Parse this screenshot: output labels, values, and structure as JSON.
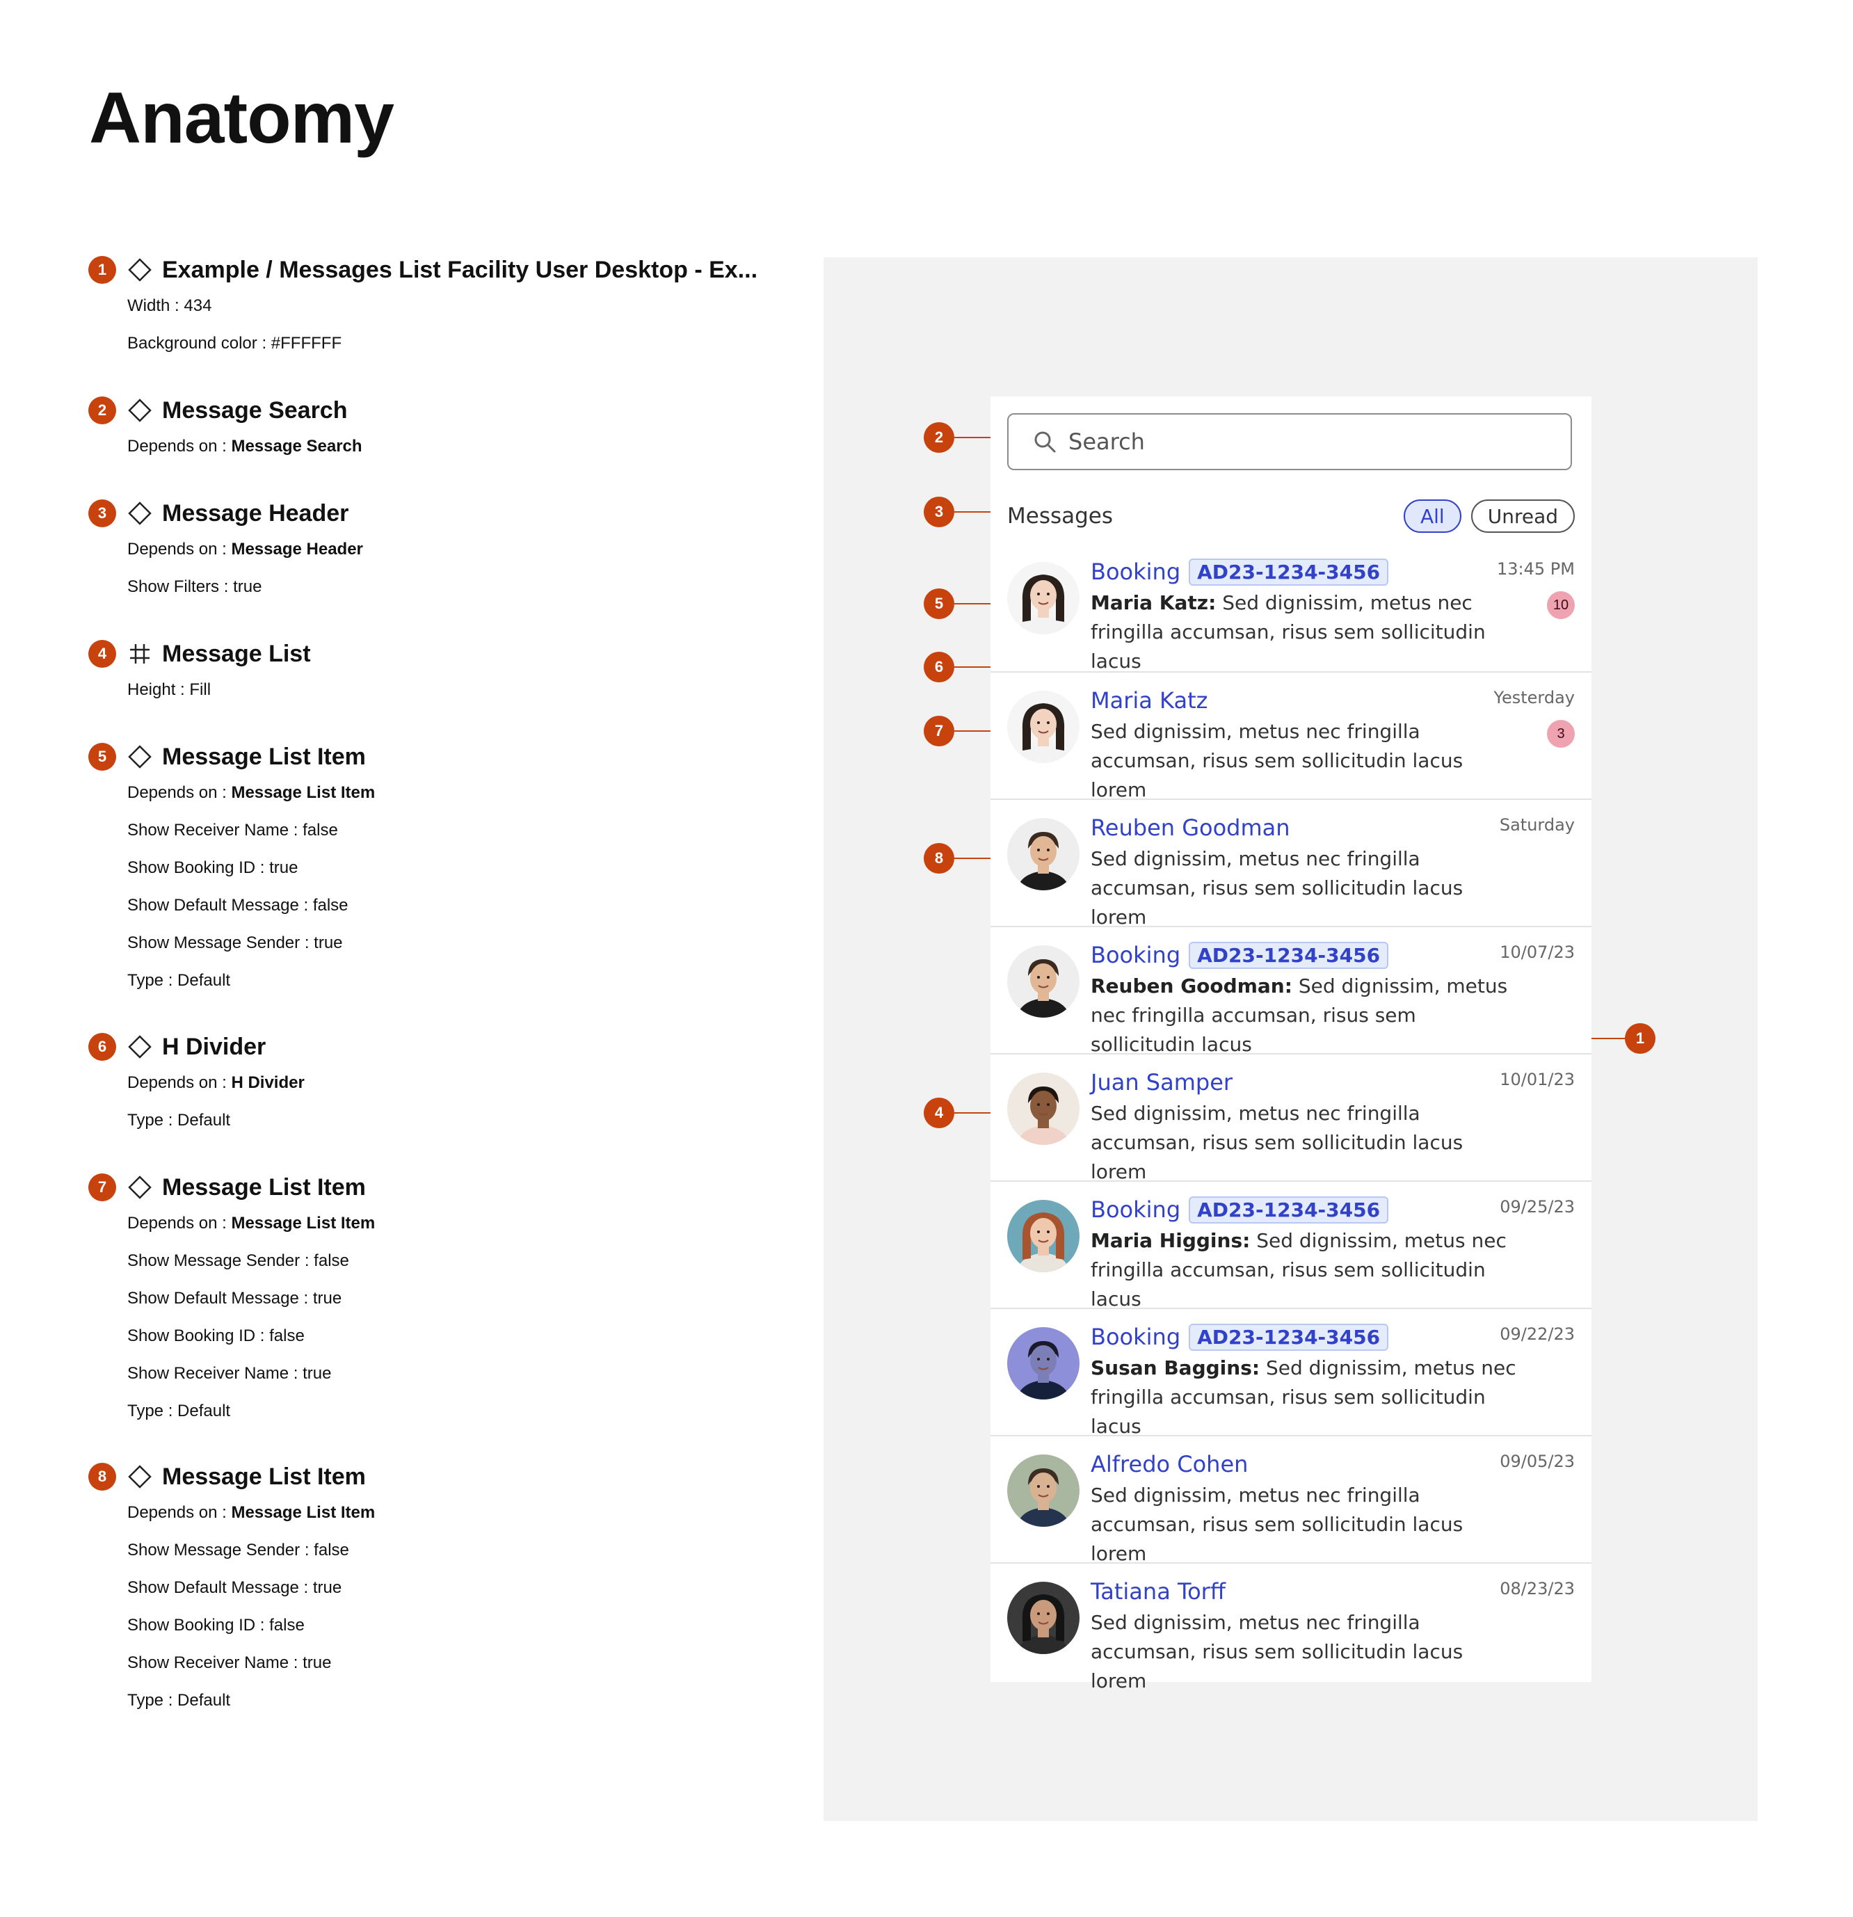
{
  "page_title": "Anatomy",
  "specs": [
    {
      "num": "1",
      "icon": "component-diamond-icon",
      "title": "Example / Messages List Facility User Desktop - Ex...",
      "props": [
        {
          "k": "Width",
          "v": "434",
          "bold": false
        },
        {
          "k": "Background color",
          "v": "#FFFFFF",
          "bold": false
        }
      ]
    },
    {
      "num": "2",
      "icon": "component-diamond-icon",
      "title": "Message Search",
      "props": [
        {
          "k": "Depends on",
          "v": "Message Search",
          "bold": true
        }
      ]
    },
    {
      "num": "3",
      "icon": "component-diamond-icon",
      "title": "Message Header",
      "props": [
        {
          "k": "Depends on",
          "v": "Message Header",
          "bold": true
        },
        {
          "k": "Show Filters",
          "v": "true",
          "bold": false
        }
      ]
    },
    {
      "num": "4",
      "icon": "frame-hash-icon",
      "title": "Message List",
      "props": [
        {
          "k": "Height",
          "v": "Fill",
          "bold": false
        }
      ]
    },
    {
      "num": "5",
      "icon": "component-diamond-icon",
      "title": "Message List Item",
      "props": [
        {
          "k": "Depends on",
          "v": "Message List Item",
          "bold": true
        },
        {
          "k": "Show Receiver Name",
          "v": "false",
          "bold": false
        },
        {
          "k": "Show Booking ID",
          "v": "true",
          "bold": false
        },
        {
          "k": "Show Default Message",
          "v": "false",
          "bold": false
        },
        {
          "k": "Show Message Sender",
          "v": "true",
          "bold": false
        },
        {
          "k": "Type",
          "v": "Default",
          "bold": false
        }
      ]
    },
    {
      "num": "6",
      "icon": "component-diamond-icon",
      "title": "H Divider",
      "props": [
        {
          "k": "Depends on",
          "v": "H Divider",
          "bold": true
        },
        {
          "k": "Type",
          "v": "Default",
          "bold": false
        }
      ]
    },
    {
      "num": "7",
      "icon": "component-diamond-icon",
      "title": "Message List Item",
      "props": [
        {
          "k": "Depends on",
          "v": "Message List Item",
          "bold": true
        },
        {
          "k": "Show Message Sender",
          "v": "false",
          "bold": false
        },
        {
          "k": "Show Default Message",
          "v": "true",
          "bold": false
        },
        {
          "k": "Show Booking ID",
          "v": "false",
          "bold": false
        },
        {
          "k": "Show Receiver Name",
          "v": "true",
          "bold": false
        },
        {
          "k": "Type",
          "v": "Default",
          "bold": false
        }
      ]
    },
    {
      "num": "8",
      "icon": "component-diamond-icon",
      "title": "Message List Item",
      "props": [
        {
          "k": "Depends on",
          "v": "Message List Item",
          "bold": true
        },
        {
          "k": "Show Message Sender",
          "v": "false",
          "bold": false
        },
        {
          "k": "Show Default Message",
          "v": "true",
          "bold": false
        },
        {
          "k": "Show Booking ID",
          "v": "false",
          "bold": false
        },
        {
          "k": "Show Receiver Name",
          "v": "true",
          "bold": false
        },
        {
          "k": "Type",
          "v": "Default",
          "bold": false
        }
      ]
    }
  ],
  "preview": {
    "search": {
      "placeholder": "Search",
      "icon": "search-icon"
    },
    "header": {
      "title": "Messages",
      "filters": [
        {
          "label": "All",
          "selected": true
        },
        {
          "label": "Unread",
          "selected": false
        }
      ]
    },
    "booking_word": "Booking",
    "messages": [
      {
        "type": "booking",
        "booking_id": "AD23-1234-3456",
        "sender": "Maria Katz:",
        "text": "Sed dignissim, metus nec fringilla accumsan, risus sem sollicitudin lacus",
        "time": "13:45 PM",
        "unread": "10",
        "avatar": {
          "skin": "#f1d3bf",
          "hair": "#2a201b",
          "shirt": "#f3f3f3",
          "bg": "#f5f5f5",
          "long": true
        }
      },
      {
        "type": "receiver",
        "name": "Maria Katz",
        "text": "Sed dignissim, metus nec fringilla accumsan, risus sem sollicitudin lacus lorem",
        "time": "Yesterday",
        "unread": "3",
        "avatar": {
          "skin": "#f1d3bf",
          "hair": "#2a201b",
          "shirt": "#f3f3f3",
          "bg": "#f5f5f5",
          "long": true
        }
      },
      {
        "type": "receiver",
        "name": "Reuben Goodman",
        "text": "Sed dignissim, metus nec fringilla accumsan, risus sem sollicitudin lacus lorem",
        "time": "Saturday",
        "unread": "",
        "avatar": {
          "skin": "#e2b795",
          "hair": "#3a2a20",
          "shirt": "#1c1c1c",
          "bg": "#eeeeee",
          "long": false
        }
      },
      {
        "type": "booking",
        "booking_id": "AD23-1234-3456",
        "sender": "Reuben Goodman:",
        "text": "Sed dignissim, metus nec fringilla accumsan, risus sem sollicitudin lacus",
        "time": "10/07/23",
        "unread": "",
        "avatar": {
          "skin": "#e2b795",
          "hair": "#3a2a20",
          "shirt": "#1c1c1c",
          "bg": "#eeeeee",
          "long": false
        }
      },
      {
        "type": "receiver",
        "name": "Juan Samper",
        "text": "Sed dignissim, metus nec fringilla accumsan, risus sem sollicitudin lacus lorem",
        "time": "10/01/23",
        "unread": "",
        "avatar": {
          "skin": "#8a5a3c",
          "hair": "#1e1510",
          "shirt": "#f0d2c8",
          "bg": "#efe9e2",
          "long": false
        }
      },
      {
        "type": "booking",
        "booking_id": "AD23-1234-3456",
        "sender": "Maria Higgins:",
        "text": "Sed dignissim, metus nec fringilla accumsan, risus sem sollicitudin lacus",
        "time": "09/25/23",
        "unread": "",
        "avatar": {
          "skin": "#f0c8ae",
          "hair": "#a8542f",
          "shirt": "#e9e4dc",
          "bg": "#6fa8b8",
          "long": true
        }
      },
      {
        "type": "booking",
        "booking_id": "AD23-1234-3456",
        "sender": "Susan Baggins:",
        "text": "Sed dignissim, metus nec fringilla accumsan, risus sem sollicitudin lacus",
        "time": "09/22/23",
        "unread": "",
        "avatar": {
          "skin": "#7c7fb7",
          "hair": "#1a1a2a",
          "shirt": "#15203a",
          "bg": "#8d8fd8",
          "long": false
        }
      },
      {
        "type": "receiver",
        "name": "Alfredo Cohen",
        "text": "Sed dignissim, metus nec fringilla accumsan, risus sem sollicitudin lacus lorem",
        "time": "09/05/23",
        "unread": "",
        "avatar": {
          "skin": "#d9b294",
          "hair": "#3b2d22",
          "shirt": "#24344f",
          "bg": "#a9b7a0",
          "long": false
        }
      },
      {
        "type": "receiver",
        "name": "Tatiana Torff",
        "text": "Sed dignissim, metus nec fringilla accumsan, risus sem sollicitudin lacus lorem",
        "time": "08/23/23",
        "unread": "",
        "avatar": {
          "skin": "#c99a7c",
          "hair": "#141414",
          "shirt": "#2b2b2b",
          "bg": "#3a3a3a",
          "long": true
        }
      }
    ]
  },
  "callouts": [
    "2",
    "3",
    "5",
    "6",
    "7",
    "8",
    "4",
    "1"
  ],
  "colors": {
    "accent": "#c7420c",
    "link": "#3142c9",
    "badge": "#efa2b0",
    "canvas": "#f2f2f2"
  }
}
